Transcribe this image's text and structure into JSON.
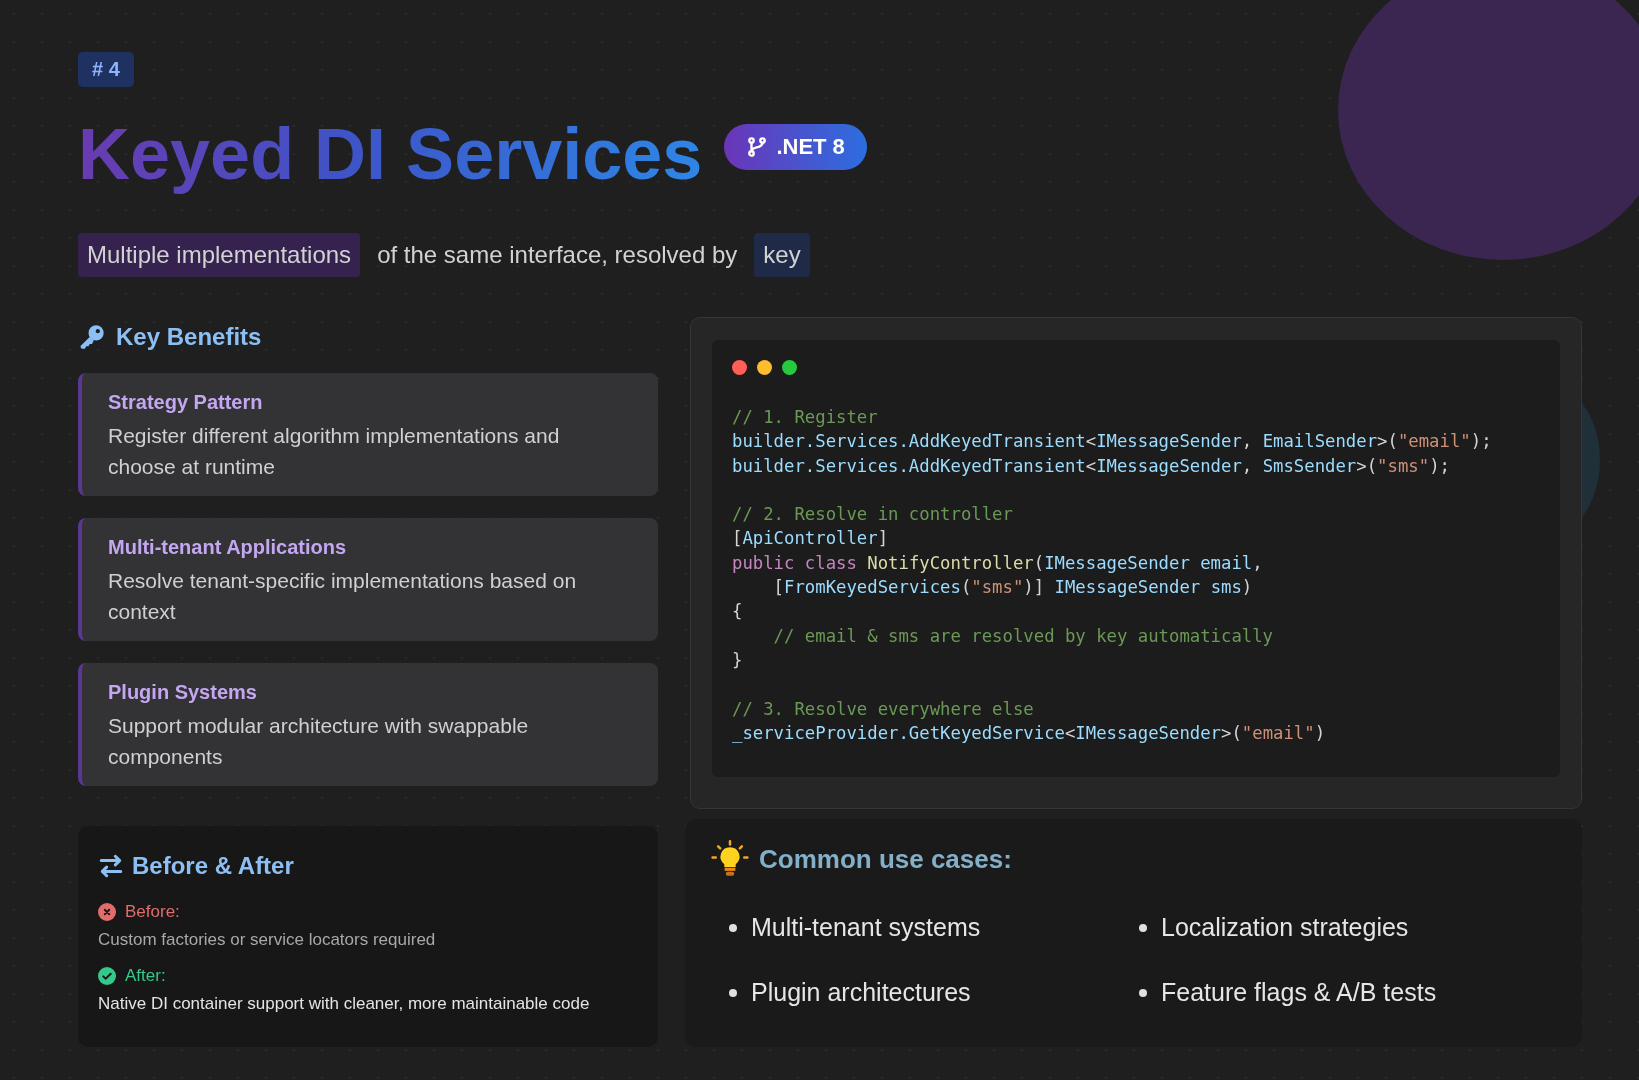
{
  "badge": "# 4",
  "title": "Keyed DI Services",
  "version_pill": ".NET 8",
  "subtitle": [
    {
      "text": "Multiple implementations",
      "color": "#35224f"
    },
    {
      "text": "of the same interface, resolved by"
    },
    {
      "text": "key",
      "color": "#1e2a48"
    }
  ],
  "benefits": {
    "heading": "Key Benefits",
    "cards": [
      {
        "title": "Strategy Pattern",
        "text": "Register different algorithm implementations and choose at runtime"
      },
      {
        "title": "Multi-tenant Applications",
        "text": "Resolve tenant-specific implementations based on context"
      },
      {
        "title": "Plugin Systems",
        "text": "Support modular architecture with swappable components"
      }
    ]
  },
  "code": {
    "blocks": [
      [
        [
          {
            "kind": "comment",
            "text": "// 1. Register"
          }
        ],
        [
          {
            "kind": "ident",
            "text": "builder.Services.AddKeyedTransient"
          },
          {
            "kind": "punct",
            "text": "<"
          },
          {
            "kind": "ident",
            "text": "IMessageSender"
          },
          {
            "kind": "punct",
            "text": ", "
          },
          {
            "kind": "ident",
            "text": "EmailSender"
          },
          {
            "kind": "punct",
            "text": ">("
          },
          {
            "kind": "string",
            "text": "\"email\""
          },
          {
            "kind": "punct",
            "text": ");"
          }
        ],
        [
          {
            "kind": "ident",
            "text": "builder.Services.AddKeyedTransient"
          },
          {
            "kind": "punct",
            "text": "<"
          },
          {
            "kind": "ident",
            "text": "IMessageSender"
          },
          {
            "kind": "punct",
            "text": ", "
          },
          {
            "kind": "ident",
            "text": "SmsSender"
          },
          {
            "kind": "punct",
            "text": ">("
          },
          {
            "kind": "string",
            "text": "\"sms\""
          },
          {
            "kind": "punct",
            "text": ");"
          }
        ]
      ],
      [
        [
          {
            "kind": "comment",
            "text": "// 2. Resolve in controller"
          }
        ],
        [
          {
            "kind": "punct",
            "text": "["
          },
          {
            "kind": "ident",
            "text": "ApiController"
          },
          {
            "kind": "punct",
            "text": "]"
          }
        ],
        [
          {
            "kind": "keyword",
            "text": "public class "
          },
          {
            "kind": "method",
            "text": "NotifyController"
          },
          {
            "kind": "punct",
            "text": "("
          },
          {
            "kind": "ident",
            "text": "IMessageSender email"
          },
          {
            "kind": "punct",
            "text": ","
          }
        ],
        [
          {
            "kind": "punct",
            "text": "    ["
          },
          {
            "kind": "ident",
            "text": "FromKeyedServices"
          },
          {
            "kind": "punct",
            "text": "("
          },
          {
            "kind": "string",
            "text": "\"sms\""
          },
          {
            "kind": "punct",
            "text": ")] "
          },
          {
            "kind": "ident",
            "text": "IMessageSender sms"
          },
          {
            "kind": "punct",
            "text": ")"
          }
        ],
        [
          {
            "kind": "punct",
            "text": "{"
          }
        ],
        [
          {
            "kind": "comment",
            "text": "    // email & sms are resolved by key automatically"
          }
        ],
        [
          {
            "kind": "punct",
            "text": "}"
          }
        ]
      ],
      [
        [
          {
            "kind": "comment",
            "text": "// 3. Resolve everywhere else"
          }
        ],
        [
          {
            "kind": "ident",
            "text": "_serviceProvider.GetKeyedService"
          },
          {
            "kind": "punct",
            "text": "<"
          },
          {
            "kind": "ident",
            "text": "IMessageSender"
          },
          {
            "kind": "punct",
            "text": ">("
          },
          {
            "kind": "string",
            "text": "\"email\""
          },
          {
            "kind": "punct",
            "text": ")"
          }
        ]
      ]
    ]
  },
  "comparison": {
    "heading": "Before & After",
    "items": [
      {
        "kind": "before",
        "label": "Before:",
        "text": "Custom factories or service locators required"
      },
      {
        "kind": "after",
        "label": "After:",
        "text": "Native DI container support with cleaner, more maintainable code"
      }
    ]
  },
  "use_cases": {
    "heading": "Common use cases:",
    "items": [
      "Multi-tenant systems",
      "Localization strategies",
      "Plugin architectures",
      "Feature flags & A/B tests"
    ]
  }
}
